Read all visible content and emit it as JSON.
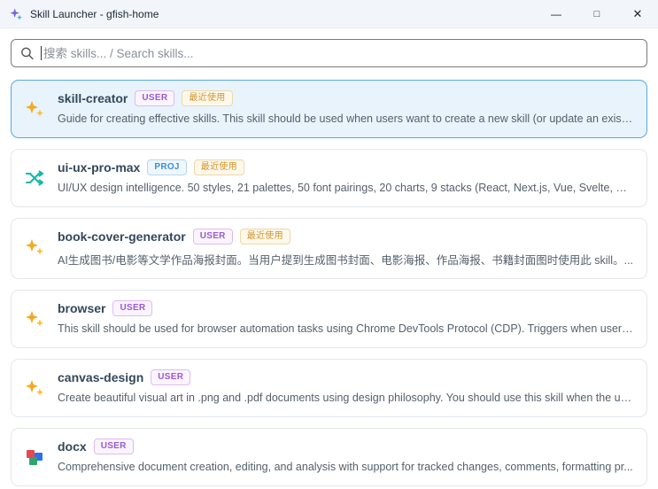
{
  "window": {
    "title": "Skill Launcher - gfish-home",
    "controls": {
      "minimize": "—",
      "maximize": "□",
      "close": "✕"
    }
  },
  "search": {
    "placeholder": "搜索 skills... / Search skills..."
  },
  "skills": [
    {
      "name": "skill-creator",
      "icon": "sparkles-icon",
      "selected": true,
      "badges": [
        {
          "label": "USER"
        },
        {
          "label": "最近使用"
        }
      ],
      "description": "Guide for creating effective skills. This skill should be used when users want to create a new skill (or update an existin..."
    },
    {
      "name": "ui-ux-pro-max",
      "icon": "shuffle-icon",
      "selected": false,
      "badges": [
        {
          "label": "PROJ"
        },
        {
          "label": "最近使用"
        }
      ],
      "description": "UI/UX design intelligence. 50 styles, 21 palettes, 50 font pairings, 20 charts, 9 stacks (React, Next.js, Vue, Svelte, Swift..."
    },
    {
      "name": "book-cover-generator",
      "icon": "sparkles-icon",
      "selected": false,
      "badges": [
        {
          "label": "USER"
        },
        {
          "label": "最近使用"
        }
      ],
      "description": "AI生成图书/电影等文学作品海报封面。当用户提到生成图书封面、电影海报、作品海报、书籍封面图时使用此 skill。..."
    },
    {
      "name": "browser",
      "icon": "sparkles-icon",
      "selected": false,
      "badges": [
        {
          "label": "USER"
        }
      ],
      "description": "This skill should be used for browser automation tasks using Chrome DevTools Protocol (CDP). Triggers when users n..."
    },
    {
      "name": "canvas-design",
      "icon": "sparkles-icon",
      "selected": false,
      "badges": [
        {
          "label": "USER"
        }
      ],
      "description": "Create beautiful visual art in .png and .pdf documents using design philosophy. You should use this skill when the us..."
    },
    {
      "name": "docx",
      "icon": "docx-blocks-icon",
      "selected": false,
      "badges": [
        {
          "label": "USER"
        }
      ],
      "description": "Comprehensive document creation, editing, and analysis with support for tracked changes, comments, formatting pr..."
    }
  ]
}
